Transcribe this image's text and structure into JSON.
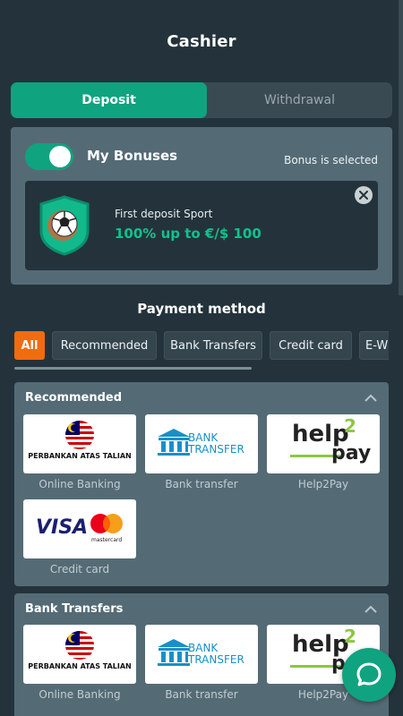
{
  "header": {
    "title": "Cashier"
  },
  "tabs": [
    {
      "label": "Deposit",
      "active": true
    },
    {
      "label": "Withdrawal",
      "active": false
    }
  ],
  "bonus": {
    "toggle_label": "My Bonuses",
    "toggle_on": true,
    "status": "Bonus is selected",
    "card": {
      "name": "First deposit Sport",
      "amount": "100% up to €/$ 100",
      "icon": "soccer-ball-shield-icon"
    }
  },
  "payment": {
    "title": "Payment method",
    "filters": [
      {
        "label": "All",
        "active": true
      },
      {
        "label": "Recommended",
        "active": false
      },
      {
        "label": "Bank Transfers",
        "active": false
      },
      {
        "label": "Credit card",
        "active": false
      },
      {
        "label": "E-W",
        "active": false
      }
    ],
    "sections": [
      {
        "title": "Recommended",
        "methods": [
          {
            "label": "Online Banking",
            "logo_text": "PERBANKAN ATAS TALIAN"
          },
          {
            "label": "Bank transfer",
            "logo_text_1": "BANK",
            "logo_text_2": "TRANSFER"
          },
          {
            "label": "Help2Pay",
            "logo_text_1": "help",
            "logo_text_2": "2",
            "logo_text_3": "pay"
          },
          {
            "label": "Credit card",
            "logo_text_1": "VISA",
            "logo_text_2": "mastercard"
          }
        ]
      },
      {
        "title": "Bank Transfers",
        "methods": [
          {
            "label": "Online Banking",
            "logo_text": "PERBANKAN ATAS TALIAN"
          },
          {
            "label": "Bank transfer",
            "logo_text_1": "BANK",
            "logo_text_2": "TRANSFER"
          },
          {
            "label": "Help2Pay",
            "logo_text_1": "help",
            "logo_text_2": "2",
            "logo_text_3": "pay"
          }
        ]
      }
    ]
  },
  "colors": {
    "accent": "#10a37f",
    "filter_active": "#f26b0f",
    "panel": "#546b76",
    "background": "#24333b"
  }
}
